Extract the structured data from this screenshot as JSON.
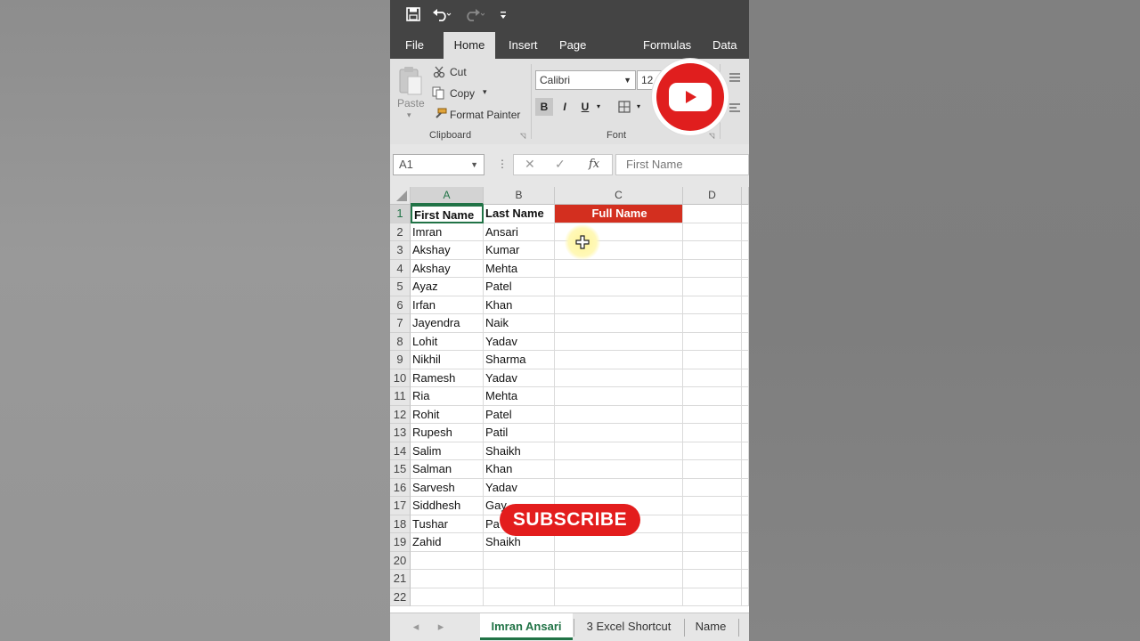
{
  "quick_access": {
    "save_icon": "floppy-disk-icon",
    "undo_icon": "undo-icon",
    "redo_icon": "redo-icon",
    "customize_icon": "customize-icon"
  },
  "tabs": [
    "File",
    "Home",
    "Insert",
    "Page Layout",
    "Formulas",
    "Data"
  ],
  "active_tab": "Home",
  "clipboard": {
    "paste": "Paste",
    "cut": "Cut",
    "copy": "Copy",
    "format_painter": "Format Painter",
    "group_label": "Clipboard"
  },
  "font": {
    "name": "Calibri",
    "size": "12",
    "bold": "B",
    "italic": "I",
    "underline": "U",
    "group_label": "Font"
  },
  "formula_bar": {
    "name_box": "A1",
    "fx": "fx",
    "value": "First Name"
  },
  "columns": [
    "A",
    "B",
    "C",
    "D"
  ],
  "headers": {
    "a": "First Name",
    "b": "Last Name",
    "c": "Full Name"
  },
  "rows": [
    {
      "n": "1"
    },
    {
      "n": "2",
      "a": "Imran",
      "b": "Ansari"
    },
    {
      "n": "3",
      "a": "Akshay",
      "b": "Kumar"
    },
    {
      "n": "4",
      "a": "Akshay",
      "b": "Mehta"
    },
    {
      "n": "5",
      "a": "Ayaz",
      "b": "Patel"
    },
    {
      "n": "6",
      "a": "Irfan",
      "b": "Khan"
    },
    {
      "n": "7",
      "a": "Jayendra",
      "b": "Naik"
    },
    {
      "n": "8",
      "a": "Lohit",
      "b": "Yadav"
    },
    {
      "n": "9",
      "a": "Nikhil",
      "b": "Sharma"
    },
    {
      "n": "10",
      "a": "Ramesh",
      "b": "Yadav"
    },
    {
      "n": "11",
      "a": "Ria",
      "b": "Mehta"
    },
    {
      "n": "12",
      "a": "Rohit",
      "b": "Patel"
    },
    {
      "n": "13",
      "a": "Rupesh",
      "b": "Patil"
    },
    {
      "n": "14",
      "a": "Salim",
      "b": "Shaikh"
    },
    {
      "n": "15",
      "a": "Salman",
      "b": "Khan"
    },
    {
      "n": "16",
      "a": "Sarvesh",
      "b": "Yadav"
    },
    {
      "n": "17",
      "a": "Siddhesh",
      "b": "Gay"
    },
    {
      "n": "18",
      "a": "Tushar",
      "b": "Pa"
    },
    {
      "n": "19",
      "a": "Zahid",
      "b": "Shaikh"
    },
    {
      "n": "20"
    },
    {
      "n": "21"
    },
    {
      "n": "22"
    }
  ],
  "sheet_tabs": [
    "Imran Ansari",
    "3 Excel Shortcut",
    "Name"
  ],
  "active_sheet": "Imran Ansari",
  "overlay": {
    "subscribe": "SUBSCRIBE",
    "youtube_icon": "youtube-logo-icon"
  },
  "colors": {
    "accent": "#217346",
    "full_name_fill": "#d32f1f",
    "ribbon_dark": "#444444"
  }
}
